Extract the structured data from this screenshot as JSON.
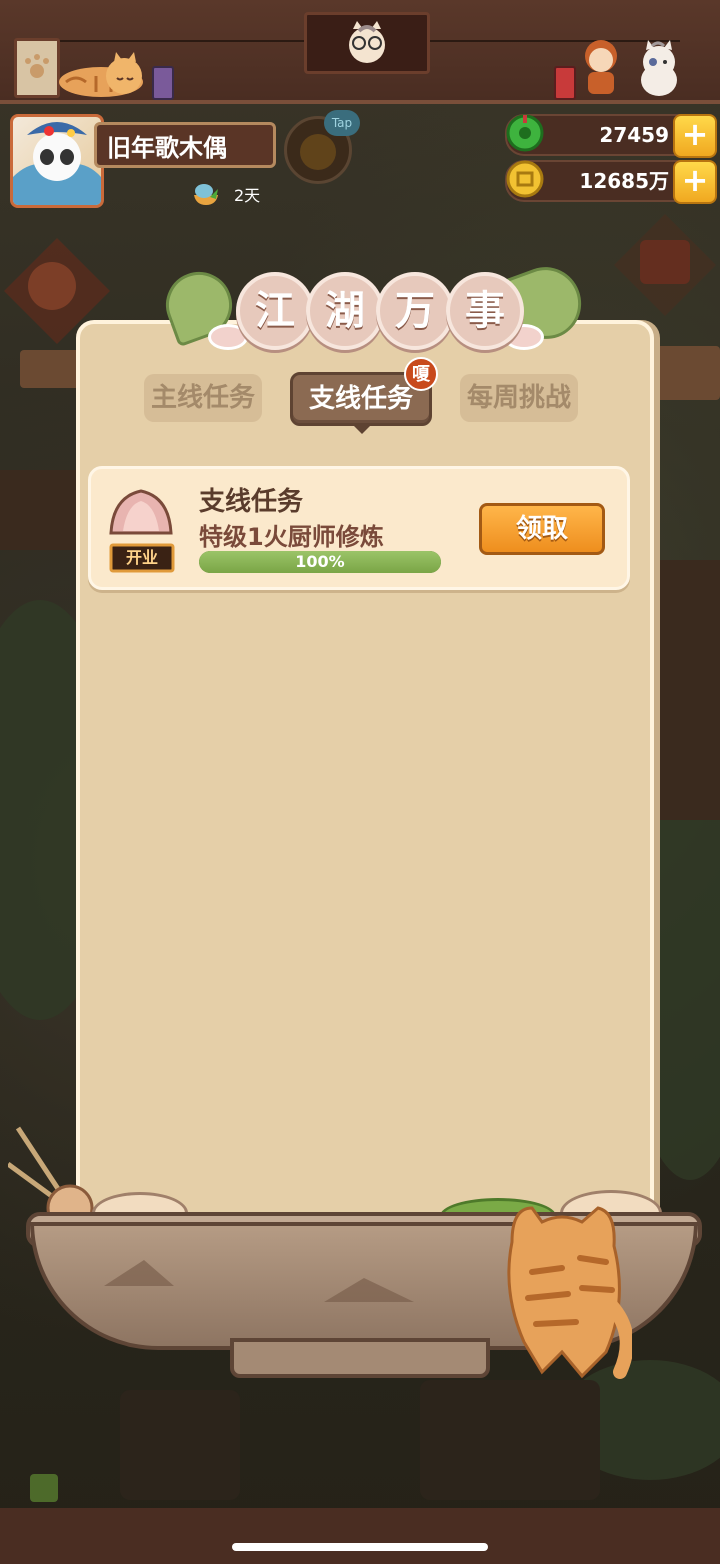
{
  "player": {
    "name": "旧年歌木偶",
    "days_label": "2天"
  },
  "tap_badge": "Tap",
  "currency": {
    "jade": "27459",
    "coins": "12685万"
  },
  "panel": {
    "title_chars": [
      "江",
      "湖",
      "万",
      "事"
    ],
    "tabs": [
      {
        "label": "主线任务",
        "active": false
      },
      {
        "label": "支线任务",
        "active": true,
        "badge": "嗄"
      },
      {
        "label": "每周挑战",
        "active": false
      }
    ]
  },
  "tasks": [
    {
      "icon_label": "开业",
      "title": "支线任务",
      "description": "特级1火厨师修炼",
      "progress_percent": 100,
      "progress_label": "100%",
      "button_label": "领取"
    }
  ],
  "colors": {
    "accent_orange": "#ee8e1e",
    "progress_green": "#7aa546",
    "panel_bg": "#e5cfa8"
  }
}
